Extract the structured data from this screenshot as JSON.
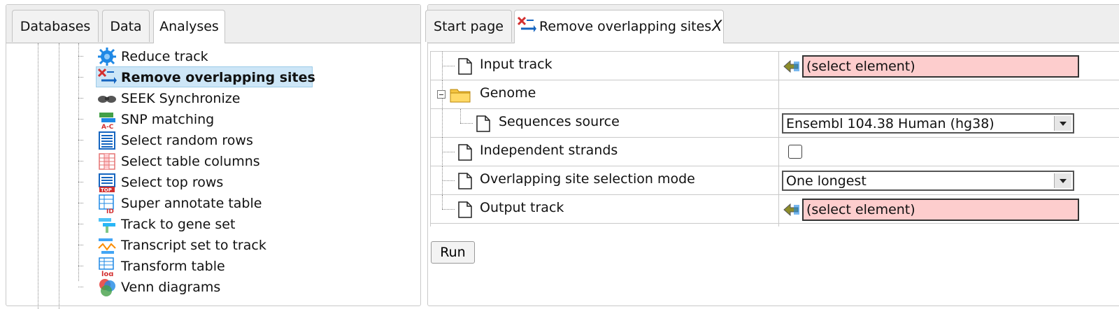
{
  "left_tabs": [
    {
      "label": "Databases"
    },
    {
      "label": "Data"
    },
    {
      "label": "Analyses",
      "active": true
    }
  ],
  "tree_items": [
    {
      "label": "Reduce track",
      "icon": "gear-icon"
    },
    {
      "label": "Remove overlapping sites",
      "icon": "remove-overlapping-icon",
      "selected": true
    },
    {
      "label": "SEEK Synchronize",
      "icon": "binoculars-icon"
    },
    {
      "label": "SNP matching",
      "icon": "snp-matching-icon"
    },
    {
      "label": "Select random rows",
      "icon": "random-rows-icon"
    },
    {
      "label": "Select table columns",
      "icon": "table-columns-icon"
    },
    {
      "label": "Select top rows",
      "icon": "top-rows-icon"
    },
    {
      "label": "Super annotate table",
      "icon": "annotate-table-icon"
    },
    {
      "label": "Track to gene set",
      "icon": "track-to-gene-icon"
    },
    {
      "label": "Transcript set to track",
      "icon": "transcript-icon"
    },
    {
      "label": "Transform table",
      "icon": "log-table-icon"
    },
    {
      "label": "Venn diagrams",
      "icon": "venn-icon"
    }
  ],
  "right_tabs": [
    {
      "label": "Start page"
    },
    {
      "label": "Remove overlapping sites",
      "active": true,
      "close_label": "X"
    }
  ],
  "params": {
    "input_track": {
      "label": "Input track",
      "value": "(select element)"
    },
    "genome": {
      "label": "Genome"
    },
    "sequences_source": {
      "label": "Sequences source",
      "value": "Ensembl 104.38 Human (hg38)"
    },
    "independent_strands": {
      "label": "Independent strands",
      "checked": false
    },
    "selection_mode": {
      "label": "Overlapping site selection mode",
      "value": "One longest"
    },
    "output_track": {
      "label": "Output track",
      "value": "(select element)"
    }
  },
  "run_label": "Run",
  "colors": {
    "selected_bg": "#cde6f7",
    "required_field": "#fdcdcd"
  }
}
